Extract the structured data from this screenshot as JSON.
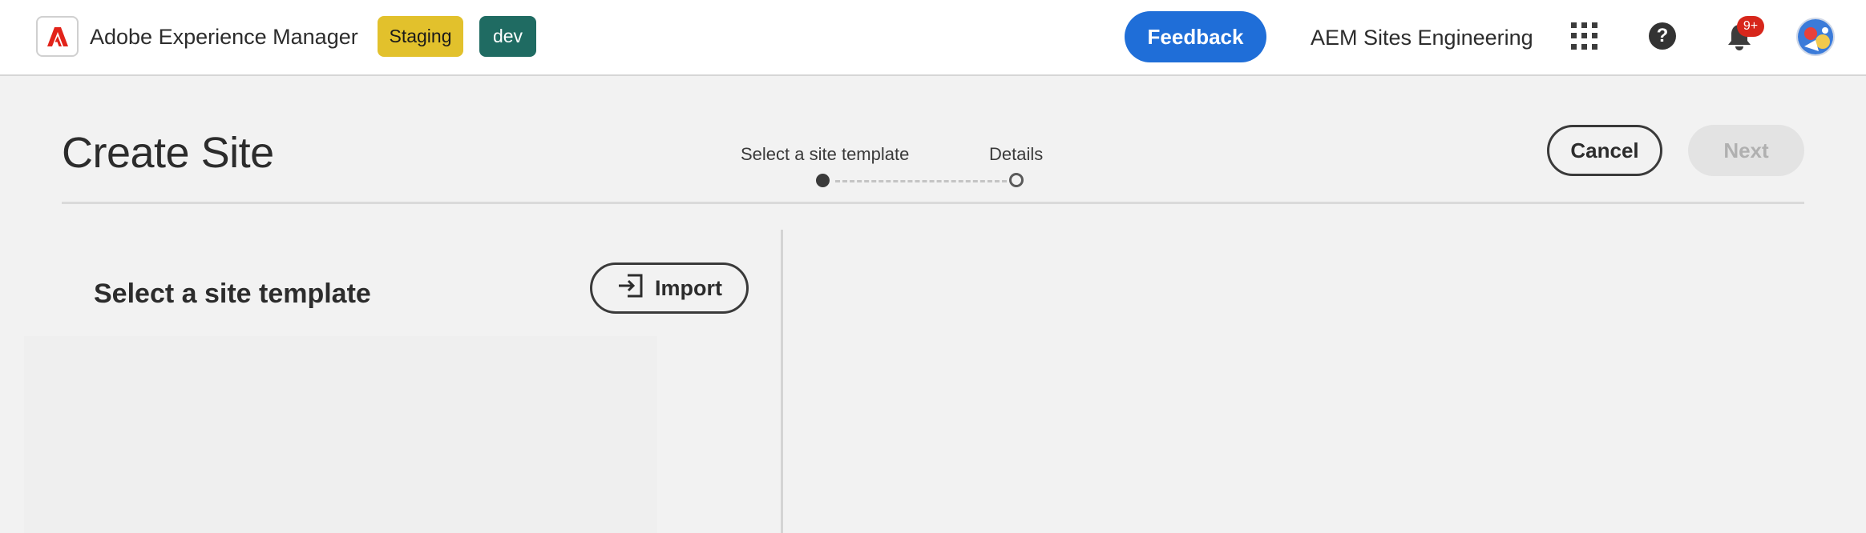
{
  "shell": {
    "app_title": "Adobe Experience Manager",
    "env_badges": [
      {
        "label": "Staging",
        "color": "#e2c12c"
      },
      {
        "label": "dev",
        "color": "#1f6b62"
      }
    ],
    "feedback_label": "Feedback",
    "org_name": "AEM Sites Engineering",
    "notification_count": "9+",
    "icons": [
      "adobe-logo-icon",
      "apps-grid-icon",
      "help-icon",
      "bell-icon",
      "avatar"
    ],
    "accent_color": "#1f6ed8"
  },
  "wizard": {
    "title": "Create Site",
    "steps": [
      {
        "label": "Select a site template",
        "active": true
      },
      {
        "label": "Details",
        "active": false
      }
    ],
    "cancel_label": "Cancel",
    "next_label": "Next"
  },
  "template_panel": {
    "heading": "Select a site template",
    "import_label": "Import"
  }
}
